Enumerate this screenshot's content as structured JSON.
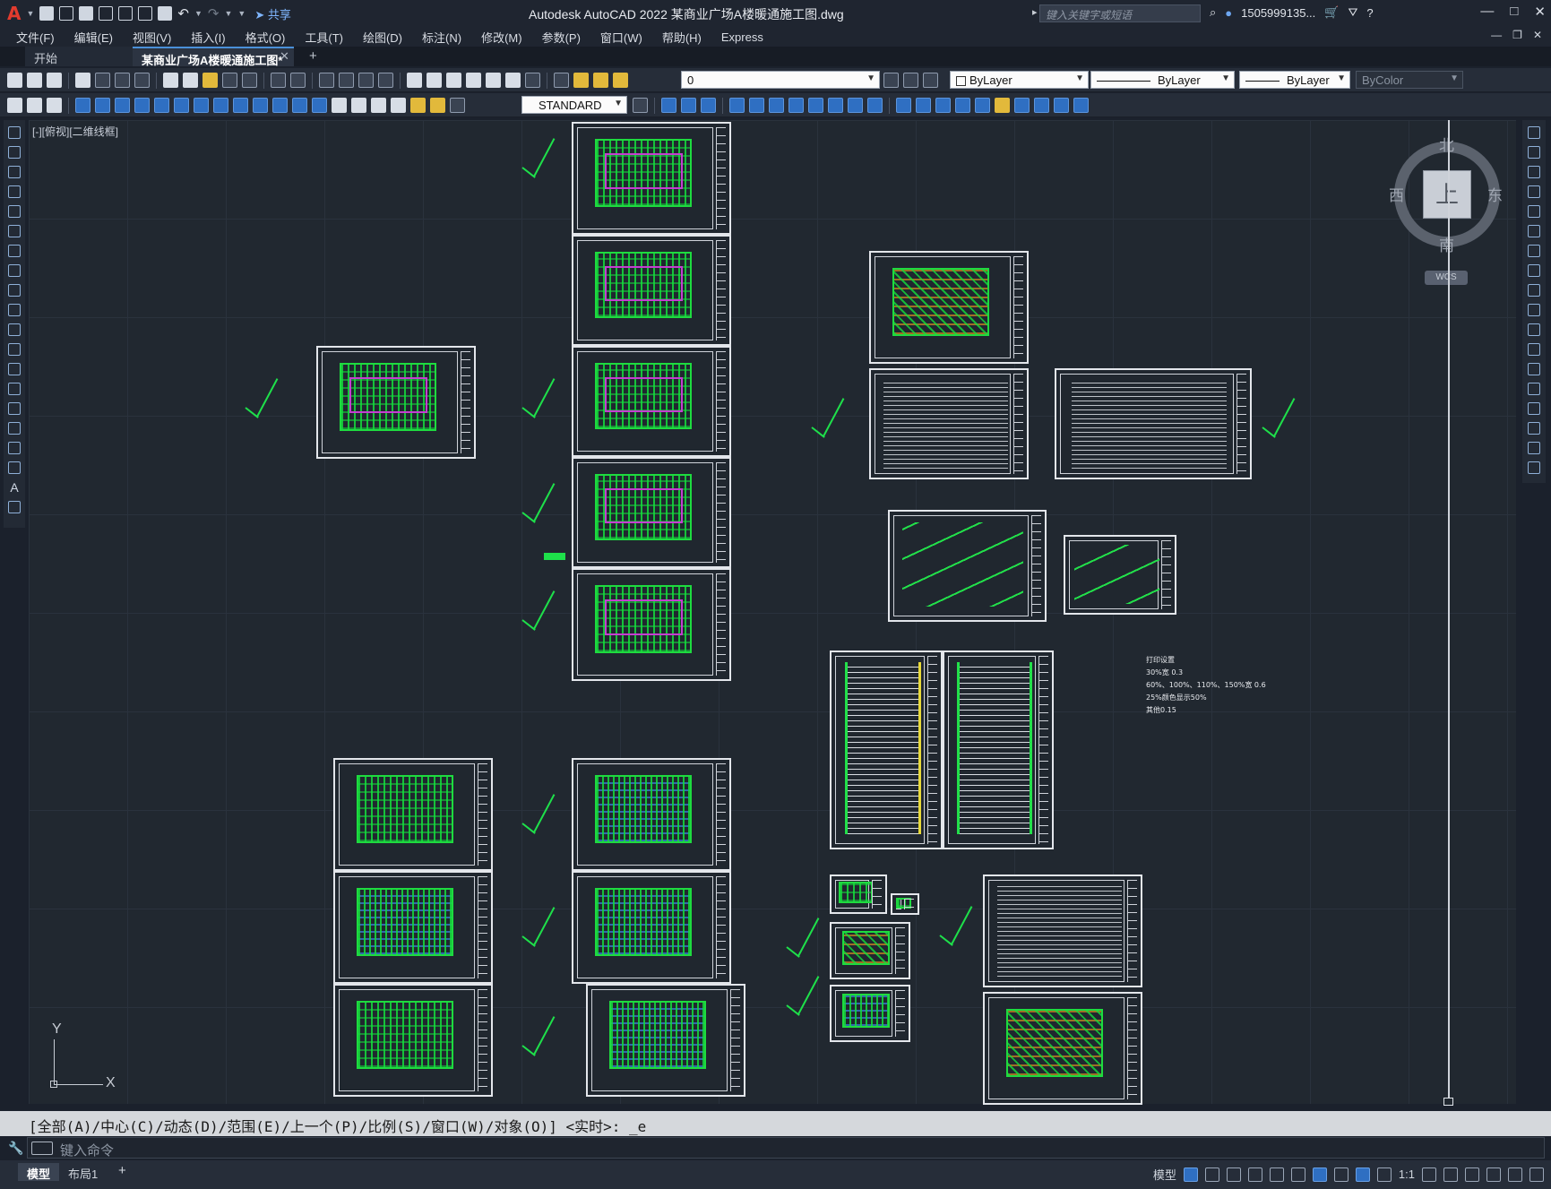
{
  "app": {
    "logo": "A",
    "title": "Autodesk AutoCAD 2022    某商业广场A楼暖通施工图.dwg",
    "share_label": "共享",
    "search_placeholder": "键入关键字或短语",
    "user": "1505999135...",
    "window_controls": [
      "—",
      "□",
      "✕"
    ]
  },
  "menu": [
    "文件(F)",
    "编辑(E)",
    "视图(V)",
    "插入(I)",
    "格式(O)",
    "工具(T)",
    "绘图(D)",
    "标注(N)",
    "修改(M)",
    "参数(P)",
    "窗口(W)",
    "帮助(H)",
    "Express"
  ],
  "tabs": {
    "start": "开始",
    "document": "某商业广场A楼暖通施工图*",
    "close": "✕",
    "add": "+"
  },
  "toolbar1": {
    "layer_value": "0",
    "color_value": "ByLayer",
    "linetype_value": "ByLayer",
    "lineweight_value": "ByLayer",
    "plotstyle_value": "ByColor"
  },
  "toolbar2": {
    "textstyle_value": "STANDARD"
  },
  "viewport_label": "[-][俯视][二维线框]",
  "viewcube": {
    "north": "北",
    "south": "南",
    "west": "西",
    "east": "东",
    "face": "上",
    "wcs": "WCS"
  },
  "ucs": {
    "x": "X",
    "y": "Y"
  },
  "print_notes": [
    "打印设置",
    "30%宽    0.3",
    "60%、100%、110%、150%宽    0.6",
    "25%颜色显示50%",
    "其他0.15"
  ],
  "command": {
    "history": "[全部(A)/中心(C)/动态(D)/范围(E)/上一个(P)/比例(S)/窗口(W)/对象(O)] <实时>: _e",
    "placeholder": "键入命令"
  },
  "status": {
    "model_tab": "模型",
    "layout_tab": "布局1",
    "add_tab": "+",
    "model_label": "模型",
    "scale": "1:1"
  },
  "colors": {
    "background": "#212830",
    "drawing_green": "#1edb3f",
    "magenta": "#c43fd0",
    "sheet_border": "#e3e6eb"
  }
}
